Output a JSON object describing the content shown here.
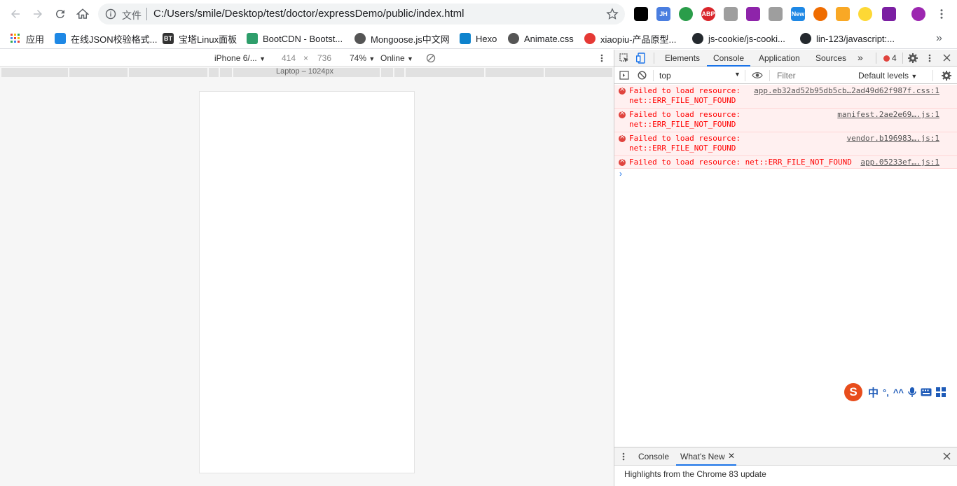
{
  "browser": {
    "url_prefix": "文件",
    "url": "C:/Users/smile/Desktop/test/doctor/expressDemo/public/index.html"
  },
  "extensions": [
    {
      "icon": "tampermonkey-icon",
      "color": "#000000",
      "label": ""
    },
    {
      "icon": "jh-icon",
      "color": "#4a7ee0",
      "label": "JH"
    },
    {
      "icon": "paw-icon",
      "color": "#2a9d4a",
      "label": ""
    },
    {
      "icon": "abp-icon",
      "color": "#d9252b",
      "label": "ABP"
    },
    {
      "icon": "vue-icon",
      "color": "#9e9e9e",
      "label": ""
    },
    {
      "icon": "eyedropper-icon",
      "color": "#8e24aa",
      "label": ""
    },
    {
      "icon": "shield-icon",
      "color": "#9e9e9e",
      "label": ""
    },
    {
      "icon": "new-icon",
      "color": "#1e88e5",
      "label": "New"
    },
    {
      "icon": "share-icon",
      "color": "#ef6c00",
      "label": ""
    },
    {
      "icon": "orange-square-icon",
      "color": "#f9a825",
      "label": ""
    },
    {
      "icon": "yellow-face-icon",
      "color": "#fdd835",
      "label": ""
    },
    {
      "icon": "puzzle-icon",
      "color": "#7b1fa2",
      "label": ""
    },
    {
      "icon": "avatar-icon",
      "color": "#9c27b0",
      "label": ""
    }
  ],
  "bookmarks": [
    {
      "icon": "apps-icon",
      "label": "应用",
      "color": "#4285f4"
    },
    {
      "icon": "code-icon",
      "label": "在线JSON校验格式...",
      "color": "#1e88e5"
    },
    {
      "icon": "bt-icon",
      "label": "宝塔Linux面板",
      "color": "#333333"
    },
    {
      "icon": "bootcdn-icon",
      "label": "BootCDN - Bootst...",
      "color": "#2e9e6b"
    },
    {
      "icon": "globe-icon",
      "label": "Mongoose.js中文网",
      "color": "#555555"
    },
    {
      "icon": "hexo-icon",
      "label": "Hexo",
      "color": "#0e83cd"
    },
    {
      "icon": "globe-icon",
      "label": "Animate.css",
      "color": "#555555"
    },
    {
      "icon": "xiaopiu-icon",
      "label": "xiaopiu-产品原型...",
      "color": "#e53935"
    },
    {
      "icon": "github-icon",
      "label": "js-cookie/js-cooki...",
      "color": "#24292e"
    },
    {
      "icon": "github-icon",
      "label": "lin-123/javascript:...",
      "color": "#24292e"
    }
  ],
  "device_toolbar": {
    "device": "iPhone 6/...",
    "width": "414",
    "times": "×",
    "height": "736",
    "zoom": "74%",
    "throttle": "Online"
  },
  "media_query": {
    "label": "Laptop – 1024px"
  },
  "devtools": {
    "tabs": [
      "Elements",
      "Console",
      "Application",
      "Sources"
    ],
    "more": "»",
    "error_count": "4",
    "context": "top",
    "filter_placeholder": "Filter",
    "levels": "Default levels",
    "messages": [
      {
        "text": "Failed to load resource: \nnet::ERR_FILE_NOT_FOUND",
        "source": "app.eb32ad52b95db5cb…2ad49d62f987f.css:1"
      },
      {
        "text": "Failed to load resource: \nnet::ERR_FILE_NOT_FOUND",
        "source": "manifest.2ae2e69….js:1"
      },
      {
        "text": "Failed to load resource: \nnet::ERR_FILE_NOT_FOUND",
        "source": "vendor.b196983….js:1"
      },
      {
        "text": "Failed to load resource: net::ERR_FILE_NOT_FOUND",
        "source": "app.05233ef….js:1"
      }
    ],
    "prompt": "›"
  },
  "ime": {
    "zh": "中",
    "punct": "°,"
  },
  "drawer": {
    "tabs": [
      "Console",
      "What's New"
    ],
    "content": "Highlights from the Chrome 83 update"
  }
}
